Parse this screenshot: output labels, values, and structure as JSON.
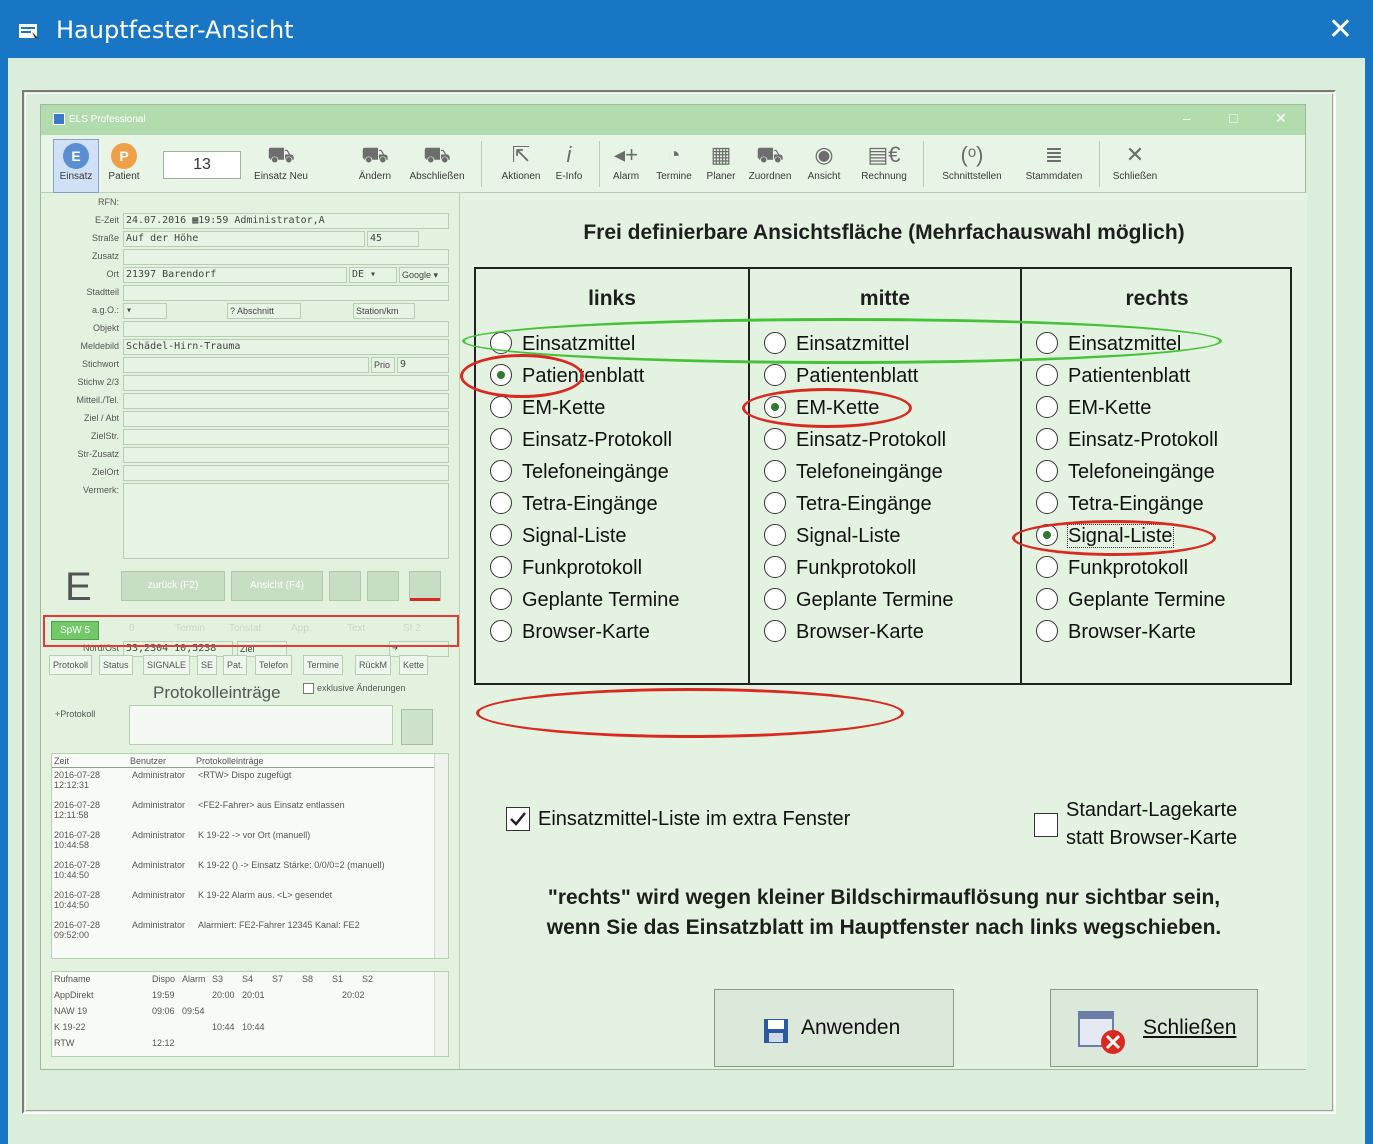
{
  "window": {
    "title": "Hauptfester-Ansicht",
    "close_glyph": "✕"
  },
  "preview": {
    "title": "ELS Professional",
    "toolbar": {
      "count": "13",
      "items": [
        "Einsatz",
        "Patient",
        "Einsatz Neu",
        "Ändern",
        "Abschließen",
        "Aktionen",
        "E-Info",
        "Alarm",
        "Termine",
        "Planer",
        "Zuordnen",
        "Ansicht",
        "Rechnung",
        "Schnittstellen",
        "Stammdaten",
        "Schließen"
      ]
    },
    "form": {
      "labels": [
        "RFN:",
        "E-Zeit",
        "Straße",
        "Zusatz",
        "Ort",
        "Stadtteil",
        "a.g.O.:",
        "Objekt",
        "Meldebild",
        "Stichwort",
        "Stichw 2/3",
        "Mitteil./Tel.",
        "Ziel / Abt",
        "ZielStr.",
        "Str-Zusatz",
        "ZielOrt",
        "Vermerk:"
      ],
      "ezeit": "24.07.2016 ▦19:59 Administrator,A",
      "strasse": "Auf der Höhe",
      "hausnr": "45",
      "ort": "21397 Barendorf",
      "land": "DE ▾",
      "google": "Google ▾",
      "abschnitt": "? Abschnitt",
      "station": "Station/km",
      "meldebild": "Schädel-Hirn-Trauma",
      "prio": "Prio",
      "prio_val": "9",
      "nordost_label": "Nord/Ost",
      "nordost": "53,2304 10,5238",
      "ziel": "Ziel",
      "big_letter": "E",
      "btn_zurueck": "zurück (F2)",
      "btn_anzeigen": "Ansicht (F4)"
    },
    "status": [
      "SpW 5",
      "0",
      "Termin",
      "Tonstat",
      "App",
      "Text",
      "St 2"
    ],
    "tabs": [
      "Protokoll",
      "Status",
      "SIGNALE",
      "SE",
      "Pat.",
      "Telefon",
      "Termine",
      "RückM",
      "Kette"
    ],
    "protokoll": {
      "title": "Protokolleinträge",
      "exclusive": "exklusive Änderungen",
      "input_label": "+Protokoll",
      "headers": [
        "Zeit",
        "Benutzer",
        "Protokolleinträge"
      ],
      "rows": [
        [
          "2016-07-28",
          "12:12:31",
          "Administrator",
          "<RTW> Dispo zugefügt"
        ],
        [
          "2016-07-28",
          "12:11:58",
          "Administrator",
          "<FE2-Fahrer> aus Einsatz entlassen"
        ],
        [
          "2016-07-28",
          "10:44:58",
          "Administrator",
          "K 19-22 -> vor Ort (manuell)"
        ],
        [
          "2016-07-28",
          "10:44:50",
          "Administrator",
          "K 19-22 () -> Einsatz  Stärke: 0/0/0=2 (manuell)"
        ],
        [
          "2016-07-28",
          "10:44:50",
          "Administrator",
          "K 19-22 Alarm aus. <L> gesendet"
        ],
        [
          "2016-07-28",
          "09:52:00",
          "Administrator",
          "Alarmiert: FE2-Fahrer 12345  Kanal: FE2"
        ]
      ]
    },
    "units": {
      "headers": [
        "Rufname",
        "Dispo",
        "Alarm",
        "S3",
        "S4",
        "S7",
        "S8",
        "S1",
        "S2"
      ],
      "rows": [
        [
          "AppDirekt",
          "19:59",
          "",
          "20:00",
          "20:01",
          "",
          "",
          "20:02"
        ],
        [
          "NAW 19",
          "09:06",
          "09:54",
          "",
          "",
          "",
          "",
          ""
        ],
        [
          "K 19-22",
          "",
          "",
          "10:44",
          "10:44",
          "",
          "",
          ""
        ],
        [
          "RTW",
          "12:12",
          "",
          "",
          "",
          "",
          "",
          ""
        ]
      ]
    }
  },
  "panel": {
    "heading": "Frei definierbare Ansichtsfläche (Mehrfachauswahl möglich)",
    "columns": [
      {
        "title": "links",
        "selected": 1
      },
      {
        "title": "mitte",
        "selected": 2
      },
      {
        "title": "rechts",
        "selected": 6
      }
    ],
    "options": [
      "Einsatzmittel",
      "Patientenblatt",
      "EM-Kette",
      "Einsatz-Protokoll",
      "Telefoneingänge",
      "Tetra-Eingänge",
      "Signal-Liste",
      "Funkprotokoll",
      "Geplante Termine",
      "Browser-Karte"
    ],
    "checkbox_extra": {
      "label": "Einsatzmittel-Liste im extra Fenster",
      "checked": true
    },
    "checkbox_standard": {
      "line1": "Standart-Lagekarte",
      "line2": "statt Browser-Karte",
      "checked": false
    },
    "note_line1": "\"rechts\" wird wegen kleiner Bildschirmauflösung nur sichtbar sein,",
    "note_line2": "wenn Sie das Einsatzblatt im Hauptfenster nach links wegschieben.",
    "apply_label": "Anwenden",
    "close_label": "Schließen"
  },
  "colors": {
    "titlebar": "#1976c4",
    "background": "#dbeedb",
    "highlight_red": "#d92a22",
    "highlight_green": "#46c23a"
  }
}
